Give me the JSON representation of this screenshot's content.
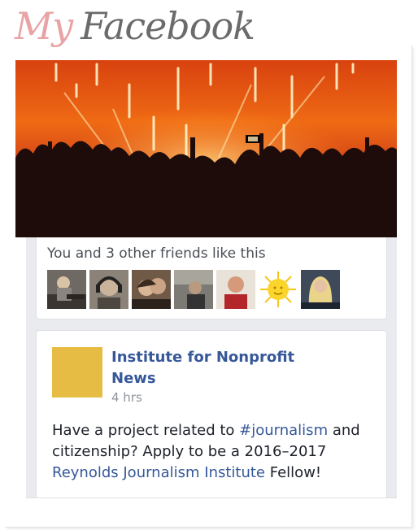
{
  "header": {
    "title_part1": "My",
    "title_part2": "Facebook"
  },
  "likes": {
    "text": "You and 3 other friends like this",
    "friends": [
      {
        "icon": "friend-photo-guitarist"
      },
      {
        "icon": "friend-photo-headphones"
      },
      {
        "icon": "friend-photo-couple"
      },
      {
        "icon": "friend-photo-man-outdoors"
      },
      {
        "icon": "friend-photo-man-red-shirt"
      },
      {
        "icon": "sun-icon"
      },
      {
        "icon": "friend-photo-woman-blonde"
      }
    ]
  },
  "post": {
    "page_name": "Institute for Nonprofit News",
    "time": "4 hrs",
    "text_1": "Have a project related to ",
    "hashtag": "#journalism",
    "text_2": " and citizenship? Apply to be a 2016–2017 ",
    "link": "Reynolds Journalism Institute",
    "text_3": " Fellow!"
  },
  "colors": {
    "title_pink": "#e9a3a5",
    "title_gray": "#6b6b6b",
    "facebook_link": "#365899",
    "avatar_yellow": "#e6bc45",
    "feed_bg": "#e9ebee"
  }
}
